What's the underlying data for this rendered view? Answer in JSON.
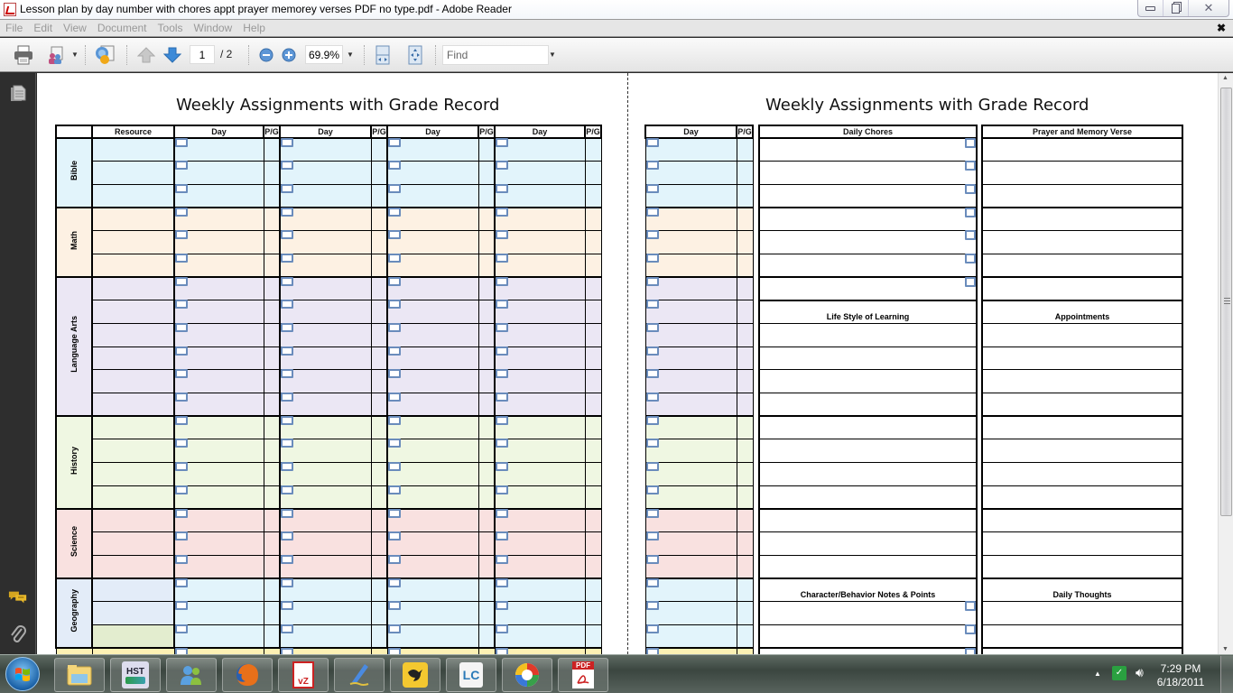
{
  "window": {
    "title": "Lesson plan by day number with chores appt prayer memorey verses PDF no type.pdf - Adobe Reader",
    "buttons": {
      "minimize": "minimize-icon",
      "restore": "restore-icon",
      "close": "close-icon"
    }
  },
  "menu": {
    "items": [
      "File",
      "Edit",
      "View",
      "Document",
      "Tools",
      "Window",
      "Help"
    ],
    "close_glyph": "✖"
  },
  "toolbar": {
    "current_page": "1",
    "total_pages": "/ 2",
    "zoom": "69.9%",
    "find_placeholder": "Find",
    "icons": [
      "print-icon",
      "share-icon",
      "collaborate-icon",
      "previous-page-icon",
      "next-page-icon",
      "zoom-out-icon",
      "zoom-in-icon",
      "fit-width-icon",
      "fit-page-icon"
    ]
  },
  "left_panel": {
    "icons": [
      "pages-icon",
      "comments-icon",
      "attachments-icon"
    ]
  },
  "page_left": {
    "title": "Weekly Assignments with Grade Record",
    "headers": [
      "",
      "Resource",
      "Day",
      "P/G",
      "Day",
      "P/G",
      "Day",
      "P/G",
      "Day",
      "P/G"
    ],
    "subjects": [
      {
        "name": "Bible",
        "rows": 3,
        "color": "#e2f4fb"
      },
      {
        "name": "Math",
        "rows": 3,
        "color": "#fdf1e3"
      },
      {
        "name": "Language Arts",
        "rows": 6,
        "color": "#ebe7f4"
      },
      {
        "name": "History",
        "rows": 4,
        "color": "#eff7e2"
      },
      {
        "name": "Science",
        "rows": 3,
        "color": "#f9e1e0"
      },
      {
        "name": "Geography",
        "rows": 3,
        "color": "#e3ecf8"
      }
    ]
  },
  "page_right": {
    "title": "Weekly Assignments with Grade Record",
    "headers": [
      "Day",
      "P/G",
      "Daily Chores",
      "Prayer and Memory Verse"
    ],
    "sections": {
      "life_style": "Life Style of Learning",
      "appointments": "Appointments",
      "character": "Character/Behavior Notes & Points",
      "daily_thoughts": "Daily Thoughts"
    }
  },
  "taskbar": {
    "apps": [
      "windows-explorer",
      "hst",
      "windows-live-messenger",
      "firefox",
      "vz-app",
      "pen-app",
      "twitter-bird-app",
      "lc-app",
      "picasa",
      "adobe-reader"
    ],
    "hst_label": "HST",
    "lc_label": "LC",
    "pdf_label": "PDF"
  },
  "tray": {
    "time": "7:29 PM",
    "date": "6/18/2011"
  }
}
